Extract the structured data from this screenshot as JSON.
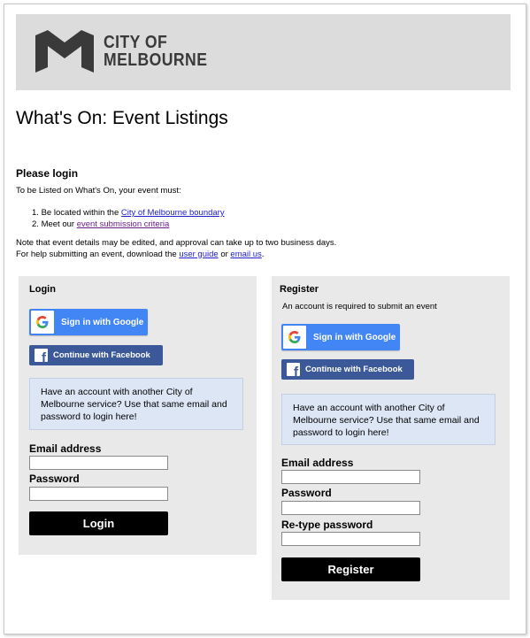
{
  "brand": {
    "logo_line1": "CITY OF",
    "logo_line2": "MELBOURNE",
    "header_bg": "#dcdcdc",
    "logo_color": "#3a3a3a"
  },
  "page": {
    "title": "What's On: Event Listings",
    "please_login": "Please login",
    "intro": "To be Listed on What's On, your event must:",
    "requirements": [
      {
        "num": "1.",
        "prefix": "Be located within the ",
        "link": "City of Melbourne boundary"
      },
      {
        "num": "2.",
        "prefix": "Meet our ",
        "link": "event submission criteria"
      }
    ],
    "note_line1": "Note that event details may be edited, and approval can take up to two business days.",
    "note_line2_prefix": "For help submitting an event, download the ",
    "note_link1": "user guide",
    "note_mid": " or ",
    "note_link2": "email us",
    "note_end": "."
  },
  "login": {
    "title": "Login",
    "google_label": "Sign in with Google",
    "facebook_label": "Continue with Facebook",
    "info": "Have an account with another City of Melbourne service? Use that same email and password to login here!",
    "email_label": "Email address",
    "password_label": "Password",
    "email_value": "",
    "password_value": "",
    "submit_label": "Login"
  },
  "register": {
    "title": "Register",
    "subtitle": "An account is required to submit an event",
    "google_label": "Sign in with Google",
    "facebook_label": "Continue with Facebook",
    "info": "Have an account with another City of Melbourne service? Use that same email and password to login here!",
    "email_label": "Email address",
    "password_label": "Password",
    "retype_label": "Re-type password",
    "email_value": "",
    "password_value": "",
    "retype_value": "",
    "submit_label": "Register"
  },
  "colors": {
    "google_blue": "#4285f4",
    "facebook_blue": "#3b5998",
    "info_bg": "#dce6f5",
    "panel_bg": "#e9e9e9",
    "link": "#2222cc",
    "link_visited": "#6a1d8a"
  },
  "icons": {
    "google": "google-g-icon",
    "facebook": "facebook-f-icon",
    "logo": "city-of-melbourne-m-logo"
  }
}
